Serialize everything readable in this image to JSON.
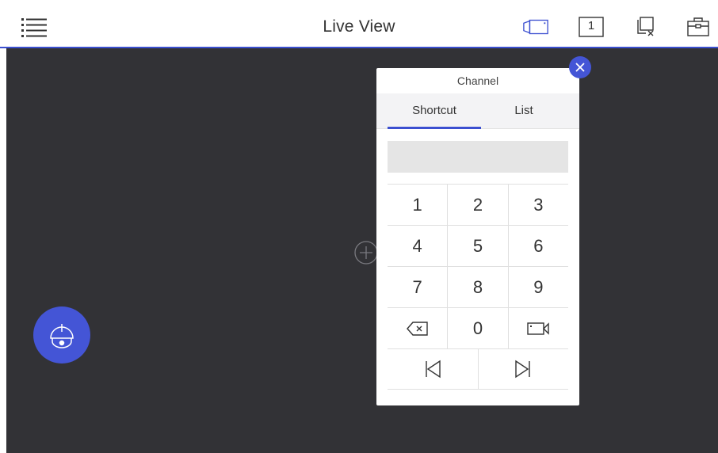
{
  "header": {
    "title": "Live View",
    "window_count": "1",
    "accent_color": "#3b4fd0"
  },
  "icons": {
    "menu": "menu-icon",
    "camera": "camera-icon",
    "window_count": "window-count-icon",
    "close_all": "close-all-windows-icon",
    "toolbox": "toolbox-icon",
    "ptz": "ptz-dome-camera-icon",
    "add_channel": "add-channel-icon"
  },
  "channel_panel": {
    "title": "Channel",
    "tabs": [
      {
        "label": "Shortcut",
        "active": true
      },
      {
        "label": "List",
        "active": false
      }
    ],
    "input_value": "",
    "keys": {
      "k1": "1",
      "k2": "2",
      "k3": "3",
      "k4": "4",
      "k5": "5",
      "k6": "6",
      "k7": "7",
      "k8": "8",
      "k9": "9",
      "k0": "0"
    },
    "special_keys": [
      "backspace-icon",
      "camera-icon",
      "previous-icon",
      "next-icon"
    ]
  }
}
